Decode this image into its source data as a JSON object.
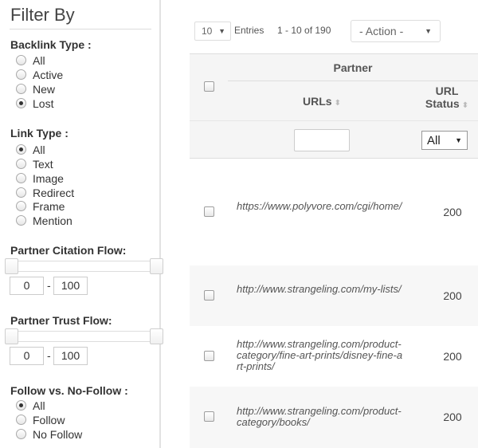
{
  "filter": {
    "title": "Filter By",
    "backlink_type": {
      "title": "Backlink Type :",
      "options": [
        "All",
        "Active",
        "New",
        "Lost"
      ],
      "selected": "Lost"
    },
    "link_type": {
      "title": "Link Type :",
      "options": [
        "All",
        "Text",
        "Image",
        "Redirect",
        "Frame",
        "Mention"
      ],
      "selected": "All"
    },
    "citation_flow": {
      "title": "Partner Citation Flow:",
      "min": "0",
      "max": "100",
      "dash": "-"
    },
    "trust_flow": {
      "title": "Partner Trust Flow:",
      "min": "0",
      "max": "100",
      "dash": "-"
    },
    "follow": {
      "title": "Follow vs. No-Follow :",
      "options": [
        "All",
        "Follow",
        "No Follow"
      ],
      "selected": "All"
    }
  },
  "toolbar": {
    "entries_value": "10",
    "entries_label": "Entries",
    "range_text": "1 - 10 of 190",
    "action_label": "- Action -"
  },
  "table": {
    "group_header": "Partner",
    "col_urls": "URLs",
    "col_status_line1": "URL",
    "col_status_line2": "Status",
    "status_filter_value": "All",
    "rows": [
      {
        "url": "https://www.polyvore.com/cgi/home/",
        "status": "200"
      },
      {
        "url": "http://www.strangeling.com/my-lists/",
        "status": "200"
      },
      {
        "url": "http://www.strangeling.com/product-category/fine-art-prints/disney-fine-art-prints/",
        "status": "200"
      },
      {
        "url": "http://www.strangeling.com/product-category/books/",
        "status": "200"
      }
    ]
  },
  "icons": {
    "caret": "caret-down-icon",
    "sort": "sort-icon"
  }
}
